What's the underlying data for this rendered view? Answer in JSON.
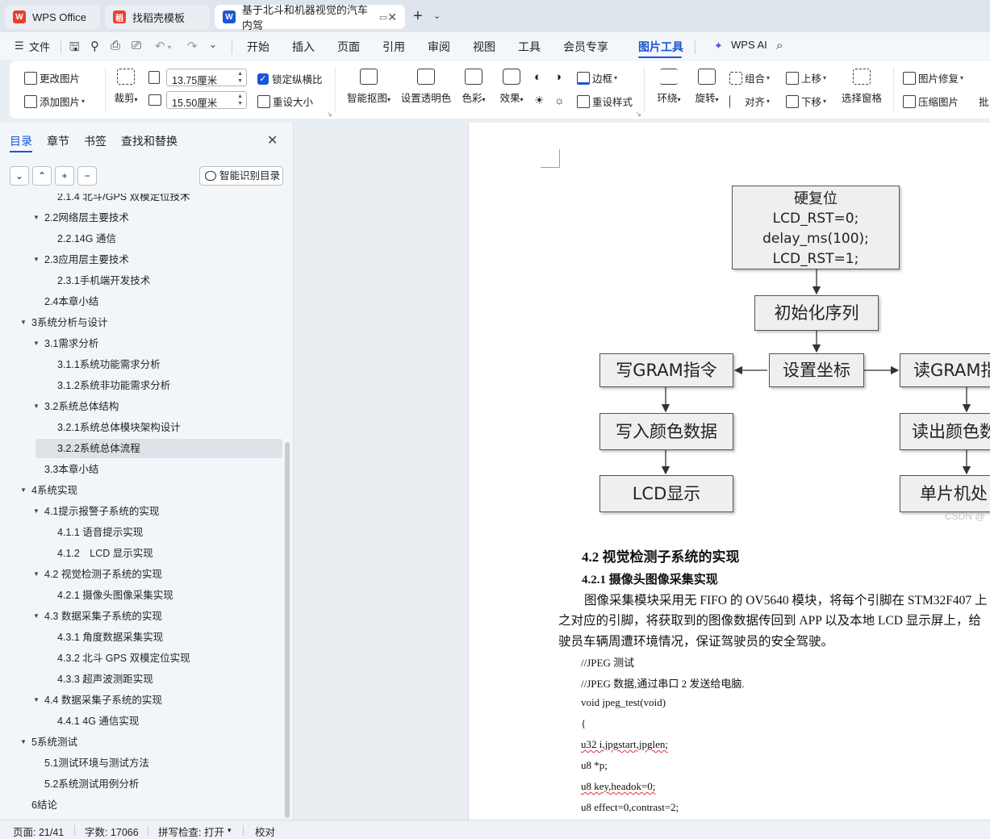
{
  "tabs": [
    {
      "label": "WPS Office",
      "logo": "W",
      "logo_color": "#e8402f"
    },
    {
      "label": "找稻壳模板",
      "logo": "稻",
      "logo_color": "#e8402f"
    },
    {
      "label": "基于北斗和机器视觉的汽车内驾",
      "logo": "W",
      "logo_color": "#1a56d8"
    }
  ],
  "menu": {
    "file": "文件",
    "items": [
      "开始",
      "插入",
      "页面",
      "引用",
      "审阅",
      "视图",
      "工具",
      "会员专享",
      "图片工具"
    ],
    "active": "图片工具",
    "wps_ai": "WPS AI"
  },
  "ribbon": {
    "change_image": "更改图片",
    "add_image": "添加图片",
    "crop": "裁剪",
    "width_value": "13.75厘米",
    "height_value": "15.50厘米",
    "lock_ratio": "锁定纵横比",
    "reset_size": "重设大小",
    "smart_cutout": "智能抠图",
    "set_transparent": "设置透明色",
    "color": "色彩",
    "effects": "效果",
    "border": "边框",
    "reset_style": "重设样式",
    "wrap": "环绕",
    "rotate": "旋转",
    "group": "组合",
    "align": "对齐",
    "bring_forward": "上移",
    "send_backward": "下移",
    "selection_pane": "选择窗格",
    "image_repair": "图片修复",
    "compress": "压缩图片",
    "batch": "批"
  },
  "nav": {
    "tabs": [
      "目录",
      "章节",
      "书签",
      "查找和替换"
    ],
    "smart_toc": "智能识别目录",
    "toc": [
      {
        "level": 3,
        "text": "2.1.4 北斗/GPS 双模定位技术",
        "arrow": false
      },
      {
        "level": 2,
        "text": "2.2网络层主要技术",
        "arrow": true
      },
      {
        "level": 3,
        "text": "2.2.14G 通信",
        "arrow": false
      },
      {
        "level": 2,
        "text": "2.3应用层主要技术",
        "arrow": true
      },
      {
        "level": 3,
        "text": "2.3.1手机端开发技术",
        "arrow": false
      },
      {
        "level": 2,
        "text": "2.4本章小结",
        "arrow": false
      },
      {
        "level": 1,
        "text": "3系统分析与设计",
        "arrow": true
      },
      {
        "level": 2,
        "text": "3.1需求分析",
        "arrow": true
      },
      {
        "level": 3,
        "text": "3.1.1系统功能需求分析",
        "arrow": false
      },
      {
        "level": 3,
        "text": "3.1.2系统非功能需求分析",
        "arrow": false
      },
      {
        "level": 2,
        "text": "3.2系统总体结构",
        "arrow": true
      },
      {
        "level": 3,
        "text": "3.2.1系统总体模块架构设计",
        "arrow": false
      },
      {
        "level": 3,
        "text": "3.2.2系统总体流程",
        "arrow": false,
        "selected": true
      },
      {
        "level": 2,
        "text": "3.3本章小结",
        "arrow": false
      },
      {
        "level": 1,
        "text": "4系统实现",
        "arrow": true
      },
      {
        "level": 2,
        "text": "4.1提示报警子系统的实现",
        "arrow": true
      },
      {
        "level": 3,
        "text": "4.1.1 语音提示实现",
        "arrow": false
      },
      {
        "level": 3,
        "text": "4.1.2　LCD 显示实现",
        "arrow": false
      },
      {
        "level": 2,
        "text": "4.2 视觉检测子系统的实现",
        "arrow": true
      },
      {
        "level": 3,
        "text": "4.2.1 摄像头图像采集实现",
        "arrow": false
      },
      {
        "level": 2,
        "text": "4.3 数据采集子系统的实现",
        "arrow": true
      },
      {
        "level": 3,
        "text": "4.3.1 角度数据采集实现",
        "arrow": false
      },
      {
        "level": 3,
        "text": "4.3.2 北斗 GPS 双模定位实现",
        "arrow": false
      },
      {
        "level": 3,
        "text": "4.3.3 超声波测距实现",
        "arrow": false
      },
      {
        "level": 2,
        "text": "4.4 数据采集子系统的实现",
        "arrow": true
      },
      {
        "level": 3,
        "text": "4.4.1 4G 通信实现",
        "arrow": false
      },
      {
        "level": 1,
        "text": "5系统测试",
        "arrow": true
      },
      {
        "level": 2,
        "text": "5.1测试环境与测试方法",
        "arrow": false
      },
      {
        "level": 2,
        "text": "5.2系统测试用例分析",
        "arrow": false
      },
      {
        "level": 1,
        "text": "6结论",
        "arrow": false
      }
    ]
  },
  "flowchart": {
    "reset": [
      "硬复位",
      "LCD_RST=0;",
      "delay_ms(100);",
      "LCD_RST=1;"
    ],
    "init": "初始化序列",
    "set_coord": "设置坐标",
    "write_gram": "写GRAM指令",
    "read_gram": "读GRAM指",
    "write_color": "写入颜色数据",
    "read_color": "读出颜色数",
    "lcd_show": "LCD显示",
    "mcu": "单片机处",
    "watermark": "CSDN @"
  },
  "doc": {
    "h2": "4.2 视觉检测子系统的实现",
    "h3": "4.2.1 摄像头图像采集实现",
    "p1": "图像采集模块采用无 FIFO 的 OV5640 模块，将每个引脚在 STM32F407 上",
    "p2": "之对应的引脚，将获取到的图像数据传回到 APP 以及本地 LCD 显示屏上，给",
    "p3": "驶员车辆周遭环境情况，保证驾驶员的安全驾驶。",
    "code": [
      "//JPEG 测试",
      "//JPEG 数据,通过串口 2 发送给电脑.",
      "void jpeg_test(void)",
      "{",
      "u32 i,jpgstart,jpglen;",
      "u8 *p;",
      "u8 key,headok=0;",
      "u8 effect=0,contrast=2;"
    ]
  },
  "status": {
    "page": "页面: 21/41",
    "words": "字数: 17066",
    "spell": "拼写检查: 打开",
    "proof": "校对"
  },
  "colors": {
    "accent": "#1a56d8",
    "wps_red": "#e8402f"
  }
}
